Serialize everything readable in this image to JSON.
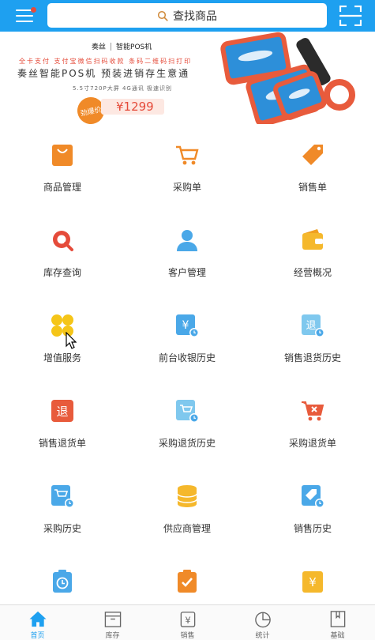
{
  "header": {
    "search_placeholder": "查找商品"
  },
  "banner": {
    "brand_logo": "奏丝",
    "brand_product": "智能POS机",
    "line1": "全卡支付 支付宝微信扫码收款 条码二维码扫打印",
    "line2": "奏丝智能POS机 预装进销存生意通",
    "line3": "5.5寸720P大屏  4G通讯  极速识别",
    "badge": "劲爆价",
    "price": "¥1299"
  },
  "grid": {
    "items": [
      {
        "label": "商品管理",
        "icon": "shopping-bag-icon"
      },
      {
        "label": "采购单",
        "icon": "shopping-cart-icon"
      },
      {
        "label": "销售单",
        "icon": "price-tag-icon"
      },
      {
        "label": "库存查询",
        "icon": "inventory-search-icon"
      },
      {
        "label": "客户管理",
        "icon": "person-icon"
      },
      {
        "label": "经营概况",
        "icon": "wallet-icon"
      },
      {
        "label": "增值服务",
        "icon": "clover-icon"
      },
      {
        "label": "前台收银历史",
        "icon": "cashier-history-icon"
      },
      {
        "label": "销售退货历史",
        "icon": "sales-return-history-icon"
      },
      {
        "label": "销售退货单",
        "icon": "return-document-icon"
      },
      {
        "label": "采购退货历史",
        "icon": "purchase-return-history-icon"
      },
      {
        "label": "采购退货单",
        "icon": "cart-remove-icon"
      },
      {
        "label": "采购历史",
        "icon": "cart-history-icon"
      },
      {
        "label": "供应商管理",
        "icon": "database-icon"
      },
      {
        "label": "销售历史",
        "icon": "tag-history-icon"
      },
      {
        "label": "",
        "icon": "clipboard-clock-icon"
      },
      {
        "label": "",
        "icon": "clipboard-check-icon"
      },
      {
        "label": "",
        "icon": "yuan-doc-icon"
      }
    ]
  },
  "tabs": [
    {
      "label": "首页",
      "icon": "home-icon",
      "active": true
    },
    {
      "label": "库存",
      "icon": "inventory-box-icon"
    },
    {
      "label": "销售",
      "icon": "sales-bag-icon"
    },
    {
      "label": "统计",
      "icon": "pie-chart-icon"
    },
    {
      "label": "基础",
      "icon": "book-icon"
    }
  ],
  "colors": {
    "primary": "#1ea0f0",
    "orange": "#f08a28",
    "red": "#e54b3a",
    "yellow": "#f5c518",
    "sky": "#4aa8e8"
  }
}
